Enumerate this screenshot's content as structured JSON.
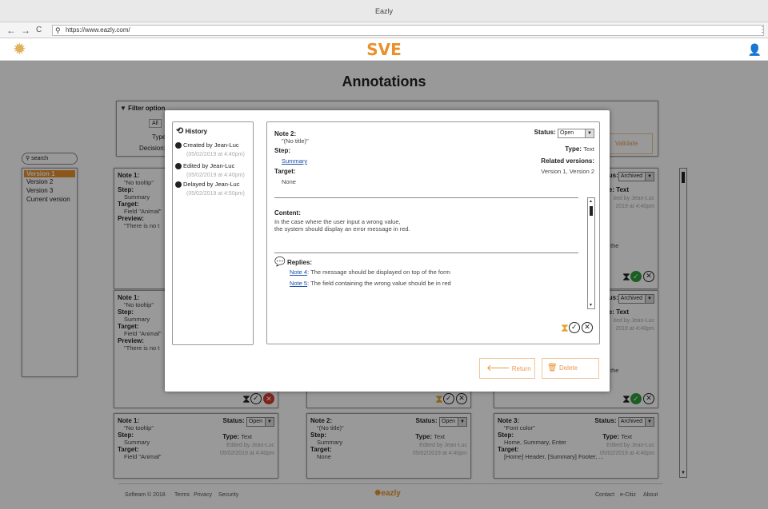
{
  "browser": {
    "title": "Eazly",
    "url": "https://www.eazly.com/",
    "back": "←",
    "forward": "→",
    "reload": "C"
  },
  "header": {
    "app_name": "SVE"
  },
  "page": {
    "title": "Annotations"
  },
  "filter": {
    "label": "Filter option",
    "all": "All",
    "type": "Type:",
    "decision": "Decision:",
    "validate": "Validate"
  },
  "sidebar": {
    "search_placeholder": "search",
    "versions": [
      "Version 1",
      "Version 2",
      "Version 3",
      "Current version"
    ]
  },
  "bg_cards": {
    "left1": {
      "title": "Note 1:",
      "sub": "\"No tooltip\"",
      "step": "Step:",
      "step_val": "Summary",
      "target": "Target:",
      "target_val": "Field \"Animal\"",
      "preview": "Preview:",
      "preview_val": "\"There is no t"
    },
    "left2": {
      "title": "Note 1:",
      "sub": "\"No tooltip\"",
      "step": "Step:",
      "step_val": "Summary",
      "target": "Target:",
      "target_val": "Field \"Animal\"",
      "preview": "Preview:",
      "preview_val": "\"There is no t"
    },
    "right1": {
      "status": "us:",
      "status_val": "Archived",
      "type": "pe: Text",
      "edited": "ited by Jean-Luc",
      "date": "2019 at 4:40pm",
      "tail": "the"
    },
    "right2": {
      "status": "us:",
      "status_val": "Archived",
      "type": "pe: Text",
      "edited": "ited by Jean-Luc",
      "date": "2019 at 4:40pm",
      "tail": "the"
    },
    "bottom1": {
      "title": "Note 1:",
      "sub": "\"No tooltip\"",
      "status": "Status:",
      "status_val": "Open",
      "step": "Step:",
      "type": "Type:",
      "type_val": "Text",
      "step_val": "Summary",
      "edited": "Edited by Jean-Luc",
      "target": "Target:",
      "date": "05/02/2019 at 4:40pm",
      "target_val": "Field \"Animal\""
    },
    "bottom2": {
      "title": "Note 2:",
      "sub": "\"(No title)\"",
      "status": "Status:",
      "status_val": "Open",
      "step": "Step:",
      "type": "Type:",
      "type_val": "Text",
      "step_val": "Summary",
      "edited": "Edited by Jean-Luc",
      "target": "Target:",
      "date": "05/02/2019 at 4:40pm",
      "target_val": "None"
    },
    "bottom3": {
      "title": "Note 3:",
      "sub": "\"Font color\"",
      "status": "Status:",
      "status_val": "Archived",
      "step": "Step:",
      "type": "Type:",
      "type_val": "Text",
      "step_val": "Home, Summary, Enter",
      "edited": "Edited by Jean-Luc",
      "target": "Target:",
      "date": "05/02/2019 at 4:40pm",
      "target_val": "[Home] Header, [Summary] Footer, ..."
    }
  },
  "history": {
    "title": "History",
    "entries": [
      {
        "label": "Created by Jean-Luc",
        "date": "(05/02/2019 at 4:40pm)"
      },
      {
        "label": "Edited by Jean-Luc",
        "date": "(05/02/2019 at 4:40pm)"
      },
      {
        "label": "Delayed by Jean-Luc",
        "date": "(05/02/2019 at 4:50pm)"
      }
    ]
  },
  "note": {
    "title": "Note 2:",
    "subtitle": "\"(No title)\"",
    "step_label": "Step:",
    "step_link": "Summary",
    "target_label": "Target:",
    "target_value": "None",
    "status_label": "Status:",
    "status_value": "Open",
    "type_label": "Type:",
    "type_value": "Text",
    "related_label": "Related versions:",
    "related_value": "Version 1, Version 2",
    "content_label": "Content:",
    "content_line1": "In the case where the user input a wrong value,",
    "content_line2": "the system should display an error message in red.",
    "replies_label": "Replies:",
    "replies": [
      {
        "link": "Note 4",
        "text": ": The message should be displayed on top of the form"
      },
      {
        "link": "Note 5",
        "text": ": The field containing the wrong value should be in red"
      }
    ]
  },
  "actions": {
    "return": "Return",
    "delete": "Delete"
  },
  "footer": {
    "copyright": "Softeam © 2018",
    "terms": "Terms",
    "privacy": "Privacy",
    "security": "Security",
    "brand": "eazly",
    "contact": "Contact",
    "ecitiz": "e-Citiz",
    "about": "About"
  },
  "colors": {
    "accent": "#e8912c",
    "link": "#1a4fa8",
    "ok_green": "#2e9b3a",
    "cancel_red": "#d53a2e"
  }
}
